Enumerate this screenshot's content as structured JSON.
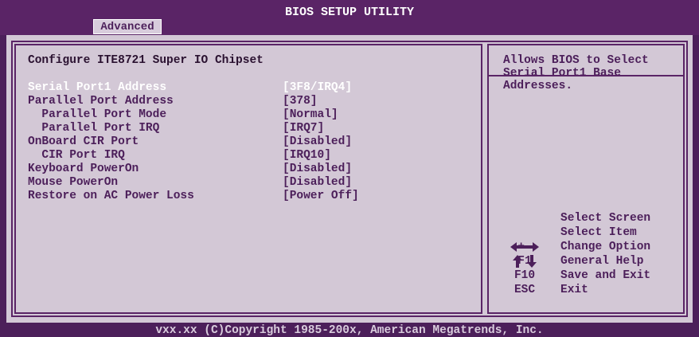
{
  "header": {
    "title": "BIOS SETUP UTILITY",
    "active_tab": "Advanced"
  },
  "section": {
    "heading": "Configure ITE8721 Super IO Chipset"
  },
  "settings": [
    {
      "label": "Serial Port1 Address",
      "value": "[3F8/IRQ4]",
      "selected": true
    },
    {
      "label": "Parallel Port Address",
      "value": "[378]"
    },
    {
      "label": "  Parallel Port Mode",
      "value": "[Normal]"
    },
    {
      "label": "  Parallel Port IRQ",
      "value": "[IRQ7]"
    },
    {
      "label": "OnBoard CIR Port",
      "value": "[Disabled]"
    },
    {
      "label": "  CIR Port IRQ",
      "value": "[IRQ10]"
    },
    {
      "label": "Keyboard PowerOn",
      "value": "[Disabled]"
    },
    {
      "label": "Mouse PowerOn",
      "value": "[Disabled]"
    },
    {
      "label": "Restore on AC Power Loss",
      "value": "[Power Off]"
    }
  ],
  "help": {
    "text": "Allows BIOS to Select Serial Port1 Base Addresses."
  },
  "keys": [
    {
      "icon": "left-right-arrows-icon",
      "key": "",
      "desc": "Select Screen"
    },
    {
      "icon": "up-down-arrows-icon",
      "key": "",
      "desc": "Select Item"
    },
    {
      "key": "+-",
      "desc": "Change Option"
    },
    {
      "key": "F1",
      "desc": "General Help"
    },
    {
      "key": "F10",
      "desc": "Save and Exit"
    },
    {
      "key": "ESC",
      "desc": "Exit"
    }
  ],
  "footer": {
    "copyright": "vxx.xx (C)Copyright 1985-200x, American Megatrends, Inc."
  },
  "colors": {
    "background": "#4c1f5a",
    "panel": "#d3c8d6",
    "text": "#4c1f5a",
    "highlight": "#ffffff"
  }
}
